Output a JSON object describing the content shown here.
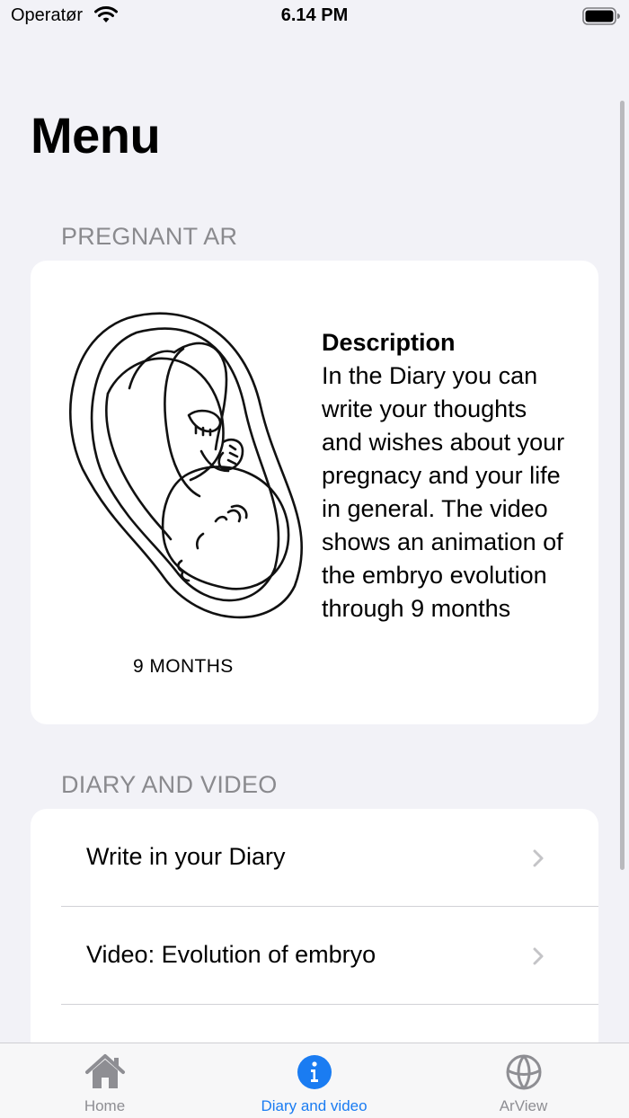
{
  "status_bar": {
    "carrier": "Operatør",
    "time": "6.14 PM",
    "icons": [
      "wifi-icon",
      "battery-icon"
    ]
  },
  "page": {
    "title": "Menu"
  },
  "sections": {
    "ar": {
      "header": "PREGNANT AR",
      "image_caption": "9 MONTHS",
      "description_title": "Description",
      "description_text": "In the Diary you can write your thoughts and wishes about your pregnacy and your life in general. The video shows an animation of the embryo evolution through 9 months"
    },
    "diary": {
      "header": "DIARY AND VIDEO",
      "items": [
        {
          "label": "Write in your Diary",
          "icon": "chevron-right-icon"
        },
        {
          "label": "Video: Evolution of embryo",
          "icon": "chevron-right-icon"
        }
      ]
    }
  },
  "tab_bar": {
    "tabs": [
      {
        "label": "Home",
        "icon": "house-icon",
        "selected": false
      },
      {
        "label": "Diary and video",
        "icon": "info-circle-icon",
        "selected": true
      },
      {
        "label": "ArView",
        "icon": "globe-icon",
        "selected": false
      }
    ],
    "colors": {
      "selected": "#1a7cf2",
      "unselected": "#8e8e93"
    }
  }
}
